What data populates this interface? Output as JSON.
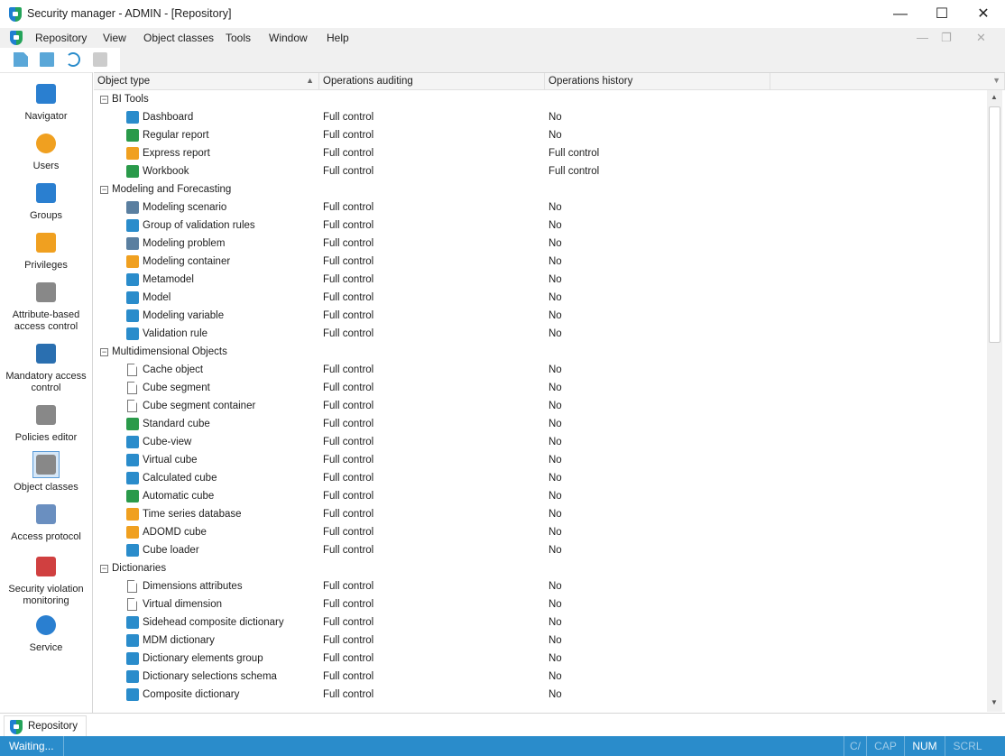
{
  "window": {
    "title": "Security manager - ADMIN - [Repository]",
    "minimize": "—",
    "maximize": "☐",
    "close": "✕"
  },
  "menu": [
    "Repository",
    "View",
    "Object classes",
    "Tools",
    "Window",
    "Help"
  ],
  "mdi": {
    "minimize": "—",
    "restore": "❐",
    "close": "✕"
  },
  "sidebar": [
    {
      "label": "Navigator",
      "icon": "navigator-icon",
      "color": "#2a7fd0"
    },
    {
      "label": "Users",
      "icon": "user-icon",
      "color": "#f0a020"
    },
    {
      "label": "Groups",
      "icon": "group-icon",
      "color": "#2a7fd0"
    },
    {
      "label": "Privileges",
      "icon": "key-icon",
      "color": "#f0a020"
    },
    {
      "label": "Attribute-based access control",
      "icon": "gear-tag-icon",
      "color": "#888"
    },
    {
      "label": "Mandatory access control",
      "icon": "stamp-icon",
      "color": "#2a6fb0"
    },
    {
      "label": "Policies editor",
      "icon": "gear-shield-icon",
      "color": "#888"
    },
    {
      "label": "Object classes",
      "icon": "gear-doc-icon",
      "color": "#888"
    },
    {
      "label": "Access protocol",
      "icon": "document-icon",
      "color": "#6a8fc0"
    },
    {
      "label": "Security violation monitoring",
      "icon": "document-error-icon",
      "color": "#d04040"
    },
    {
      "label": "Service",
      "icon": "gear-icon",
      "color": "#2a7fd0"
    }
  ],
  "columns": [
    "Object type",
    "Operations auditing",
    "Operations history"
  ],
  "groups": [
    {
      "name": "BI Tools",
      "items": [
        [
          "Dashboard",
          "Full control",
          "No",
          "#2a8ccb"
        ],
        [
          "Regular report",
          "Full control",
          "No",
          "#2a9a4a"
        ],
        [
          "Express report",
          "Full control",
          "Full control",
          "#f0a020"
        ],
        [
          "Workbook",
          "Full control",
          "Full control",
          "#2a9a4a"
        ]
      ]
    },
    {
      "name": "Modeling and Forecasting",
      "items": [
        [
          "Modeling scenario",
          "Full control",
          "No",
          "#5a7fa0"
        ],
        [
          "Group of validation rules",
          "Full control",
          "No",
          "#2a8ccb"
        ],
        [
          "Modeling problem",
          "Full control",
          "No",
          "#5a7fa0"
        ],
        [
          "Modeling container",
          "Full control",
          "No",
          "#f0a020"
        ],
        [
          "Metamodel",
          "Full control",
          "No",
          "#2a8ccb"
        ],
        [
          "Model",
          "Full control",
          "No",
          "#2a8ccb"
        ],
        [
          "Modeling variable",
          "Full control",
          "No",
          "#2a8ccb"
        ],
        [
          "Validation rule",
          "Full control",
          "No",
          "#2a8ccb"
        ]
      ]
    },
    {
      "name": "Multidimensional Objects",
      "items": [
        [
          "Cache object",
          "Full control",
          "No",
          "doc"
        ],
        [
          "Cube segment",
          "Full control",
          "No",
          "doc"
        ],
        [
          "Cube segment container",
          "Full control",
          "No",
          "doc"
        ],
        [
          "Standard cube",
          "Full control",
          "No",
          "#2a9a4a"
        ],
        [
          "Cube-view",
          "Full control",
          "No",
          "#2a8ccb"
        ],
        [
          "Virtual cube",
          "Full control",
          "No",
          "#2a8ccb"
        ],
        [
          "Calculated cube",
          "Full control",
          "No",
          "#2a8ccb"
        ],
        [
          "Automatic cube",
          "Full control",
          "No",
          "#2a9a4a"
        ],
        [
          "Time series database",
          "Full control",
          "No",
          "#f0a020"
        ],
        [
          "ADOMD cube",
          "Full control",
          "No",
          "#f0a020"
        ],
        [
          "Cube loader",
          "Full control",
          "No",
          "#2a8ccb"
        ]
      ]
    },
    {
      "name": "Dictionaries",
      "items": [
        [
          "Dimensions attributes",
          "Full control",
          "No",
          "doc"
        ],
        [
          "Virtual dimension",
          "Full control",
          "No",
          "doc"
        ],
        [
          "Sidehead composite dictionary",
          "Full control",
          "No",
          "#2a8ccb"
        ],
        [
          "MDM dictionary",
          "Full control",
          "No",
          "#2a8ccb"
        ],
        [
          "Dictionary elements group",
          "Full control",
          "No",
          "#2a8ccb"
        ],
        [
          "Dictionary selections schema",
          "Full control",
          "No",
          "#2a8ccb"
        ],
        [
          "Composite dictionary",
          "Full control",
          "No",
          "#2a8ccb"
        ]
      ]
    }
  ],
  "tab": "Repository",
  "status": {
    "text": "Waiting...",
    "caps": "CAP",
    "num": "NUM",
    "scrl": "SCRL",
    "ca": "C/"
  }
}
